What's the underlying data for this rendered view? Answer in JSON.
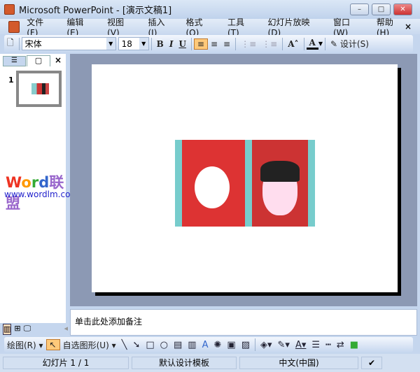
{
  "window": {
    "title": "Microsoft PowerPoint - [演示文稿1]",
    "minimize": "–",
    "maximize": "□",
    "close": "✕"
  },
  "menu": [
    "文件(F)",
    "编辑(E)",
    "视图(V)",
    "插入(I)",
    "格式(O)",
    "工具(T)",
    "幻灯片放映(D)",
    "窗口(W)",
    "帮助(H)"
  ],
  "menu_close": "×",
  "toolbar": {
    "font": "宋体",
    "size": "18",
    "bold": "B",
    "italic": "I",
    "underline": "U",
    "grow_font": "A˄",
    "font_color": "A",
    "design": "设计(S)"
  },
  "panel": {
    "tab_outline": "☰",
    "tab_slides": "▢",
    "close": "×",
    "slide_number": "1"
  },
  "watermark": {
    "brand": "Word联盟",
    "url": "www.wordlm.com"
  },
  "notes": {
    "placeholder": "单击此处添加备注"
  },
  "drawbar": {
    "draw": "绘图(R)",
    "autoshapes": "自选图形(U)"
  },
  "status": {
    "slide": "幻灯片 1 / 1",
    "template": "默认设计模板",
    "language": "中文(中国)"
  },
  "colors": {
    "accent": "#ffc97a",
    "stage": "#8c99b4"
  }
}
